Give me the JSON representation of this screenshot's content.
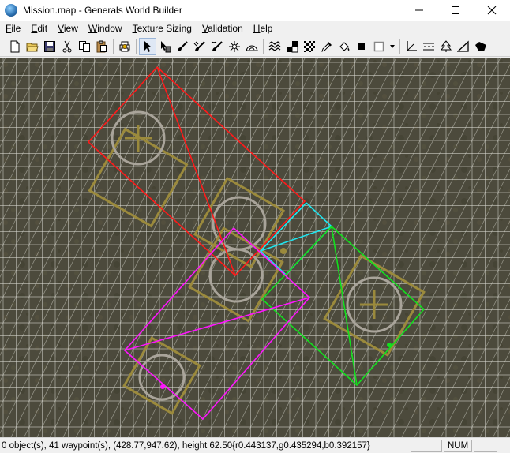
{
  "window": {
    "title": "Mission.map - Generals World Builder",
    "app_icon": "globe-icon",
    "controls": [
      "minimize-icon",
      "maximize-icon",
      "close-icon"
    ]
  },
  "menu": {
    "items": [
      {
        "label": "File"
      },
      {
        "label": "Edit"
      },
      {
        "label": "View"
      },
      {
        "label": "Window"
      },
      {
        "label": "Texture Sizing"
      },
      {
        "label": "Validation"
      },
      {
        "label": "Help"
      }
    ]
  },
  "toolbar": {
    "groups": [
      [
        "new-file-icon",
        "open-folder-icon",
        "save-icon",
        "cut-icon",
        "copy-icon",
        "paste-icon"
      ],
      [
        "print-icon"
      ],
      [
        "pointer-icon",
        "object-pick-icon",
        "brush-icon",
        "feather-brush-icon",
        "smooth-brush-icon",
        "explosion-icon",
        "crater-icon"
      ],
      [
        "water-icon",
        "checker-paint-icon",
        "tile-pattern-icon",
        "eyedropper-icon",
        "fill-bucket-icon",
        "black-square-icon",
        "white-square-icon",
        "dropdown-arrow-icon"
      ],
      [
        "axis-icon",
        "road-icon",
        "tree-icon",
        "ramp-icon",
        "blend-icon"
      ]
    ]
  },
  "map": {
    "background_color": "#4c4a3c",
    "grid_color": "#d8d8d0",
    "marker_color": "#9b8a3c",
    "shape_colors": {
      "red": "#ff1a1a",
      "cyan": "#1ee6f0",
      "green": "#12e01e",
      "magenta": "#ff14ff"
    }
  },
  "status": {
    "text": "0 object(s), 41 waypoint(s), (428.77,947.62), height 62.50{r0.443137,g0.435294,b0.392157}",
    "empty_pane": "",
    "num_indicator": "NUM",
    "extra_pane": ""
  }
}
